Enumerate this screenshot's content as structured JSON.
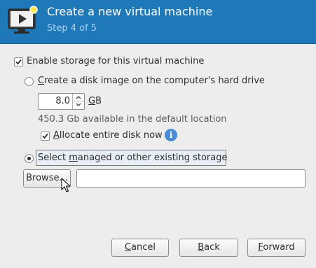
{
  "header": {
    "title": "Create a new virtual machine",
    "step": "Step 4 of 5",
    "icon": "vm-monitor-icon"
  },
  "storage": {
    "enable_label": "Enable storage for this virtual machine",
    "enable_checked": true,
    "create_disk_label": "Create a disk image on the computer's hard drive",
    "disk_size_value": "8.0",
    "disk_size_unit": "GB",
    "available_text": "450.3 Gb available in the default location",
    "allocate_label": "Allocate entire disk now",
    "allocate_checked": true,
    "select_existing_label": "Select managed or other existing storage",
    "selected_option": "select_existing",
    "browse_label": "Browse...",
    "path_value": ""
  },
  "footer": {
    "cancel_label": "Cancel",
    "back_label": "Back",
    "forward_label": "Forward"
  },
  "colors": {
    "header_bg": "#1f79b8",
    "step_text": "#a9d1ef",
    "info_icon": "#4a8cd3"
  }
}
